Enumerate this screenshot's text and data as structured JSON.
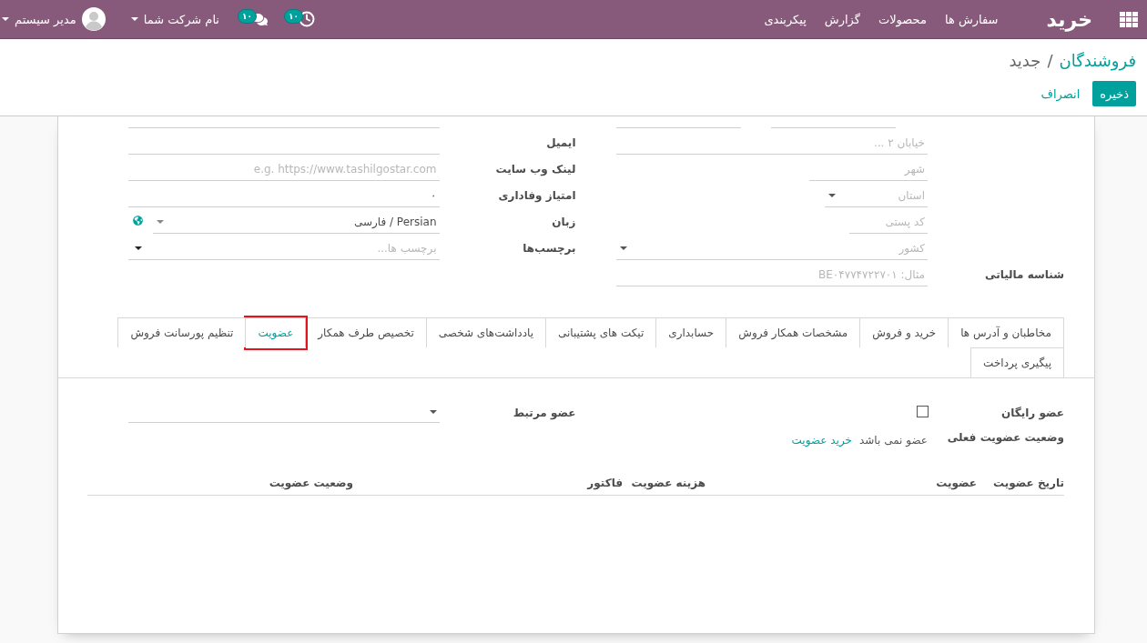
{
  "navbar": {
    "brand": "خرید",
    "menu": [
      "سفارش ها",
      "محصولات",
      "گزارش",
      "پیکربندی"
    ],
    "activity_count": "۱۰",
    "message_count": "۱۰",
    "company": "نام شرکت شما",
    "user": "مدیر سیستم"
  },
  "breadcrumb": {
    "items": [
      "فروشندگان",
      "جدید"
    ],
    "separator": "/"
  },
  "actions": {
    "save": "ذخیره",
    "discard": "انصراف"
  },
  "partner_form": {
    "contact_fields": [
      {
        "kind": "clipped"
      },
      {
        "kind": "text",
        "label": "ایمیل"
      },
      {
        "kind": "text",
        "label": "لینک وب سایت",
        "placeholder": "e.g. https://www.tashilgostar.com"
      },
      {
        "kind": "text",
        "label": "امتیاز وفاداری",
        "value": "۰"
      },
      {
        "kind": "language",
        "label": "زبان",
        "value": "Persian / فارسی"
      },
      {
        "kind": "tags",
        "label": "برچسب‌ها",
        "placeholder": "برچسب ها..."
      }
    ],
    "address_fields": [
      {
        "kind": "clipped_pair"
      },
      {
        "kind": "text",
        "placeholder": "خیابان ۲ ..."
      },
      {
        "kind": "text",
        "placeholder": "شهر"
      },
      {
        "kind": "select",
        "placeholder": "استان"
      },
      {
        "kind": "text",
        "placeholder": "کد پستی"
      },
      {
        "kind": "select",
        "placeholder": "کشور"
      }
    ],
    "tax_id": {
      "label": "شناسه مالیاتی",
      "placeholder": "مثال: BE۰۴۷۷۴۷۲۲۷۰۱"
    }
  },
  "tabs": [
    {
      "label": "مخاطبان و آدرس ها",
      "selected": false,
      "highlighted": false
    },
    {
      "label": "خرید و فروش",
      "selected": false,
      "highlighted": false
    },
    {
      "label": "مشخصات همکار فروش",
      "selected": false,
      "highlighted": false
    },
    {
      "label": "حسابداری",
      "selected": false,
      "highlighted": false
    },
    {
      "label": "تیکت های پشتیبانی",
      "selected": false,
      "highlighted": false
    },
    {
      "label": "یادداشت‌های شخصی",
      "selected": false,
      "highlighted": false
    },
    {
      "label": "تخصیص طرف همکار",
      "selected": false,
      "highlighted": false
    },
    {
      "label": "عضویت",
      "selected": true,
      "highlighted": true
    },
    {
      "label": "تنظیم پورسانت فروش",
      "selected": false,
      "highlighted": false
    },
    {
      "label": "پیگیری پرداخت",
      "selected": false,
      "highlighted": false
    }
  ],
  "membership": {
    "free_member": {
      "label": "عضو رایگان",
      "checked": false
    },
    "status": {
      "label": "وضعیت عضویت فعلی",
      "value": "عضو نمی باشد",
      "link": "خرید عضویت"
    },
    "associate": {
      "label": "عضو مرتبط"
    },
    "table": {
      "columns": [
        "تاریخ عضویت",
        "عضویت",
        "هزینه عضویت",
        "فاکتور",
        "وضعیت عضویت"
      ]
    }
  }
}
